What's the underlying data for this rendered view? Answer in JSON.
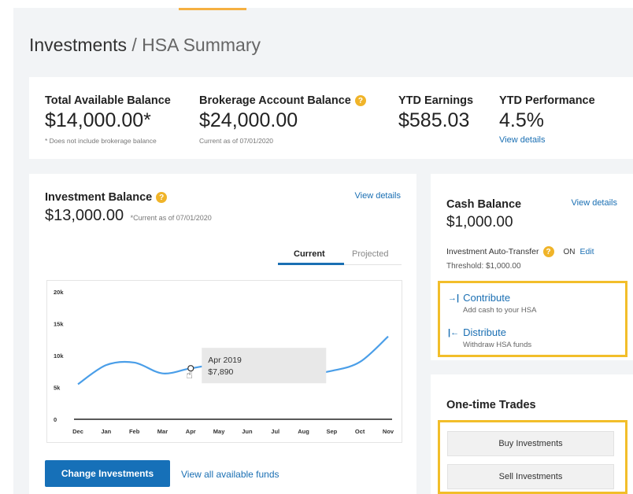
{
  "breadcrumb": {
    "section": "Investments",
    "separator": "/",
    "page": "HSA Summary"
  },
  "summary": {
    "total_available": {
      "label": "Total Available Balance",
      "value": "$14,000.00*",
      "note": "* Does not include brokerage balance"
    },
    "brokerage": {
      "label": "Brokerage Account Balance",
      "help_icon": "?",
      "value": "$24,000.00",
      "note": "Current as of 07/01/2020"
    },
    "ytd_earnings": {
      "label": "YTD Earnings",
      "value": "$585.03"
    },
    "ytd_performance": {
      "label": "YTD Performance",
      "value": "4.5%",
      "link": "View details"
    }
  },
  "investment": {
    "title": "Investment Balance",
    "help_icon": "?",
    "balance": "$13,000.00",
    "note": "*Current as of 07/01/2020",
    "view_details": "View details",
    "tabs": [
      "Current",
      "Projected"
    ],
    "active_tab": "Current",
    "tooltip": {
      "label": "Apr 2019",
      "value": "$7,890"
    },
    "change_button": "Change Investments",
    "view_funds": "View all available funds"
  },
  "chart_data": {
    "type": "line",
    "x": [
      "Dec",
      "Jan",
      "Feb",
      "Mar",
      "Apr",
      "May",
      "Jun",
      "Jul",
      "Aug",
      "Sep",
      "Oct",
      "Nov"
    ],
    "y_tick_labels": [
      "20k",
      "15k",
      "10k",
      "5k",
      "0"
    ],
    "ylim": [
      0,
      20000
    ],
    "series": [
      {
        "values": [
          5500,
          8500,
          8900,
          7200,
          8000,
          8500,
          7600,
          7300,
          7000,
          7600,
          9000,
          13000
        ]
      }
    ],
    "grid": false,
    "line_color": "#4a9ee8"
  },
  "cash": {
    "title": "Cash Balance",
    "view_details": "View details",
    "balance": "$1,000.00",
    "auto_transfer_label": "Investment Auto-Transfer",
    "help_icon": "?",
    "auto_transfer_state": "ON",
    "edit": "Edit",
    "threshold": "Threshold: $1,000.00",
    "contribute": {
      "icon": "→|",
      "label": "Contribute",
      "sub": "Add cash to your HSA"
    },
    "distribute": {
      "icon": "|←",
      "label": "Distribute",
      "sub": "Withdraw HSA funds"
    }
  },
  "trades": {
    "title": "One-time Trades",
    "buy": "Buy Investments",
    "sell": "Sell Investments"
  },
  "colors": {
    "accent": "#1670b8",
    "highlight": "#f2be2a",
    "help": "#f0b429"
  }
}
